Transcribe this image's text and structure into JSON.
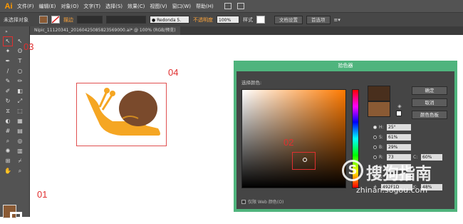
{
  "menubar": {
    "logo": "Ai",
    "items": [
      "文件(F)",
      "编辑(E)",
      "对象(O)",
      "文字(T)",
      "选择(S)",
      "效果(C)",
      "视图(V)",
      "窗口(W)",
      "帮助(H)"
    ]
  },
  "control_bar": {
    "selection_label": "未选择对象",
    "stroke_label": "描边",
    "brush_value": "Redonda 5.",
    "opacity_label": "不透明度",
    "opacity_value": "100%",
    "style_label": "样式",
    "doc_setup_button": "文档设置",
    "preferences_button": "首选项"
  },
  "document_tab": {
    "title": "Nipic_11120341_20160425085823569000.ai* @ 100% (RGB/预览)"
  },
  "annotations": {
    "label_01": "01",
    "label_02": "02",
    "label_03": "03",
    "label_04": "04"
  },
  "colors": {
    "fill": "#8a5a34",
    "new_color": "#492f1d",
    "snail_body": "#f5a623",
    "snail_shell": "#7a4a2c",
    "dialog_border": "#4fb47d"
  },
  "color_picker": {
    "title": "拾色器",
    "select_color_label": "选择颜色:",
    "ok_button": "确定",
    "cancel_button": "取消",
    "swatches_button": "颜色色板",
    "fields": [
      {
        "label": "H:",
        "value": "25°",
        "selected": true
      },
      {
        "label": "S:",
        "value": "61%",
        "selected": false
      },
      {
        "label": "B:",
        "value": "29%",
        "selected": false
      },
      {
        "label": "R:",
        "value": "73",
        "selected": false
      },
      {
        "label": "G:",
        "value": "",
        "selected": false
      },
      {
        "label": "B:",
        "value": "",
        "selected": false
      }
    ],
    "cmyk_fields": [
      {
        "label": "C:",
        "value": "60%"
      },
      {
        "label": "K:",
        "value": "48%"
      }
    ],
    "hex_label": "#",
    "hex_value": "492F1D",
    "web_only_label": "仅限 Web 颜色(O)"
  },
  "watermark": {
    "cn_text": "搜狗指南",
    "url": "zhinan.sogou.com",
    "icon_letter": "S"
  }
}
